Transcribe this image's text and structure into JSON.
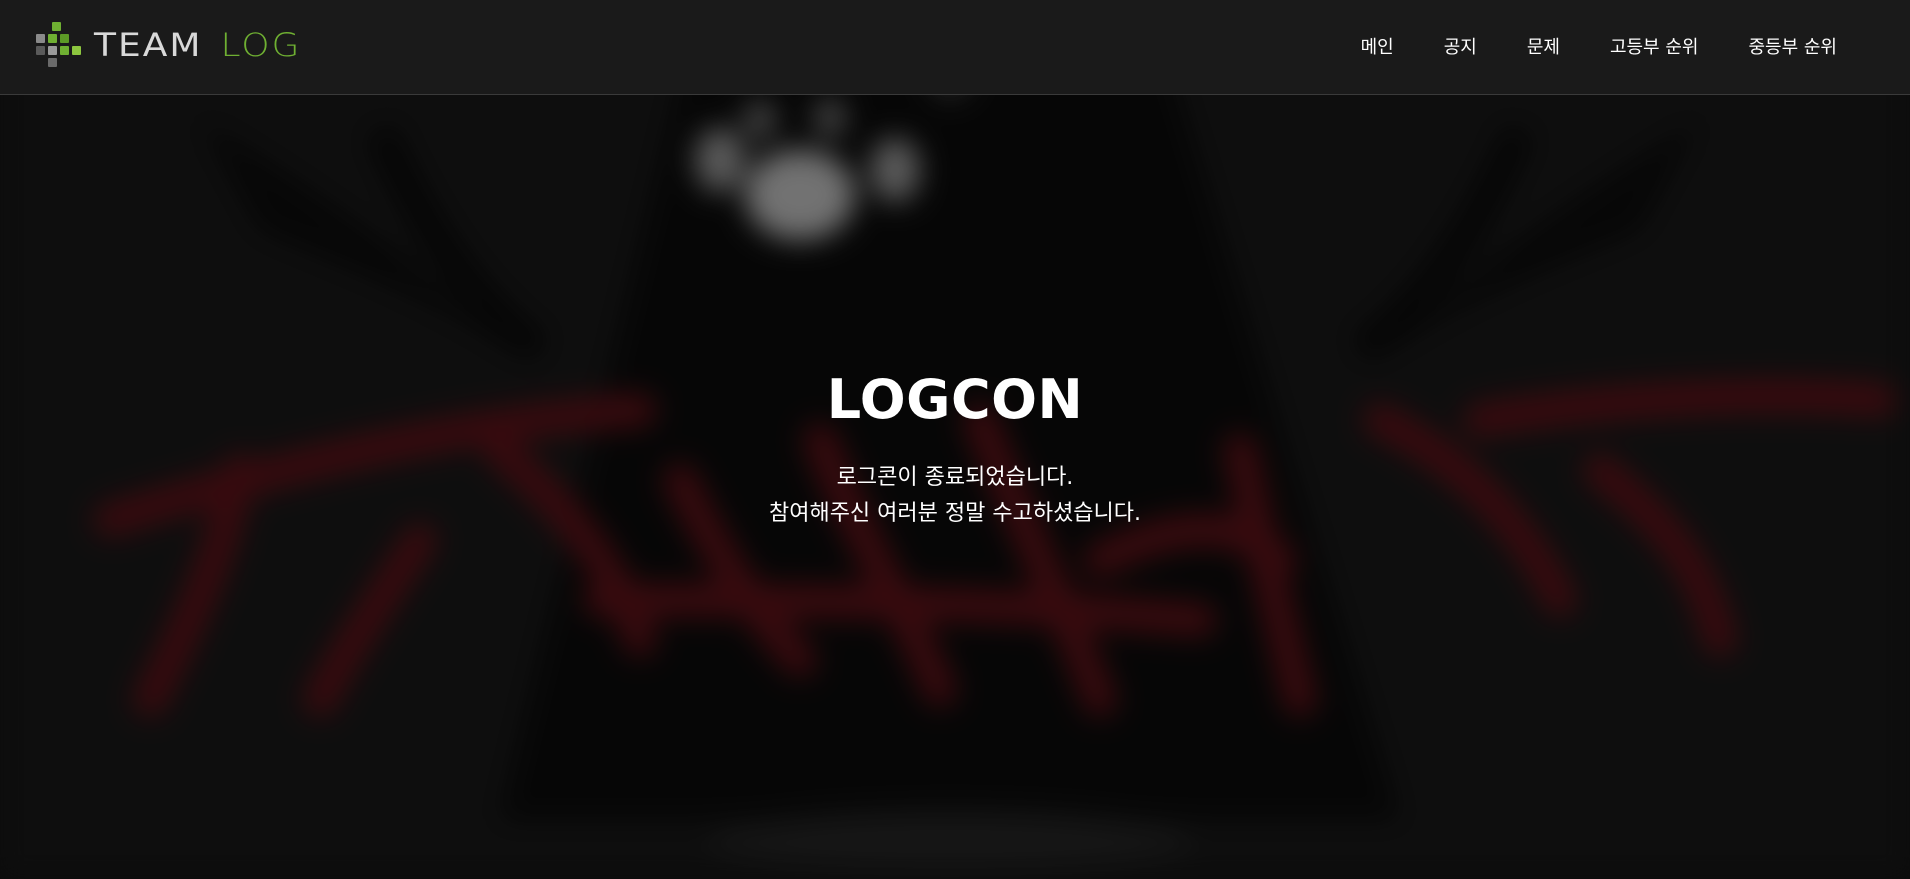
{
  "brand": {
    "name_part1": "TEAM",
    "name_part2": "LOG",
    "logo_icon": "pixel-grid-logo-icon",
    "accent_color": "#6fb032",
    "text_color": "#d9d9d9"
  },
  "nav": {
    "items": [
      {
        "label": "메인"
      },
      {
        "label": "공지"
      },
      {
        "label": "문제"
      },
      {
        "label": "고등부 순위"
      },
      {
        "label": "중등부 순위"
      }
    ]
  },
  "hero": {
    "title": "LOGCON",
    "lines": [
      "로그콘이 종료되었습니다.",
      "참여해주신 여러분 정말 수고하셨습니다."
    ],
    "background_image": "blurred-teamlog-emblem-background",
    "background_accent_color": "#5a0e12"
  }
}
